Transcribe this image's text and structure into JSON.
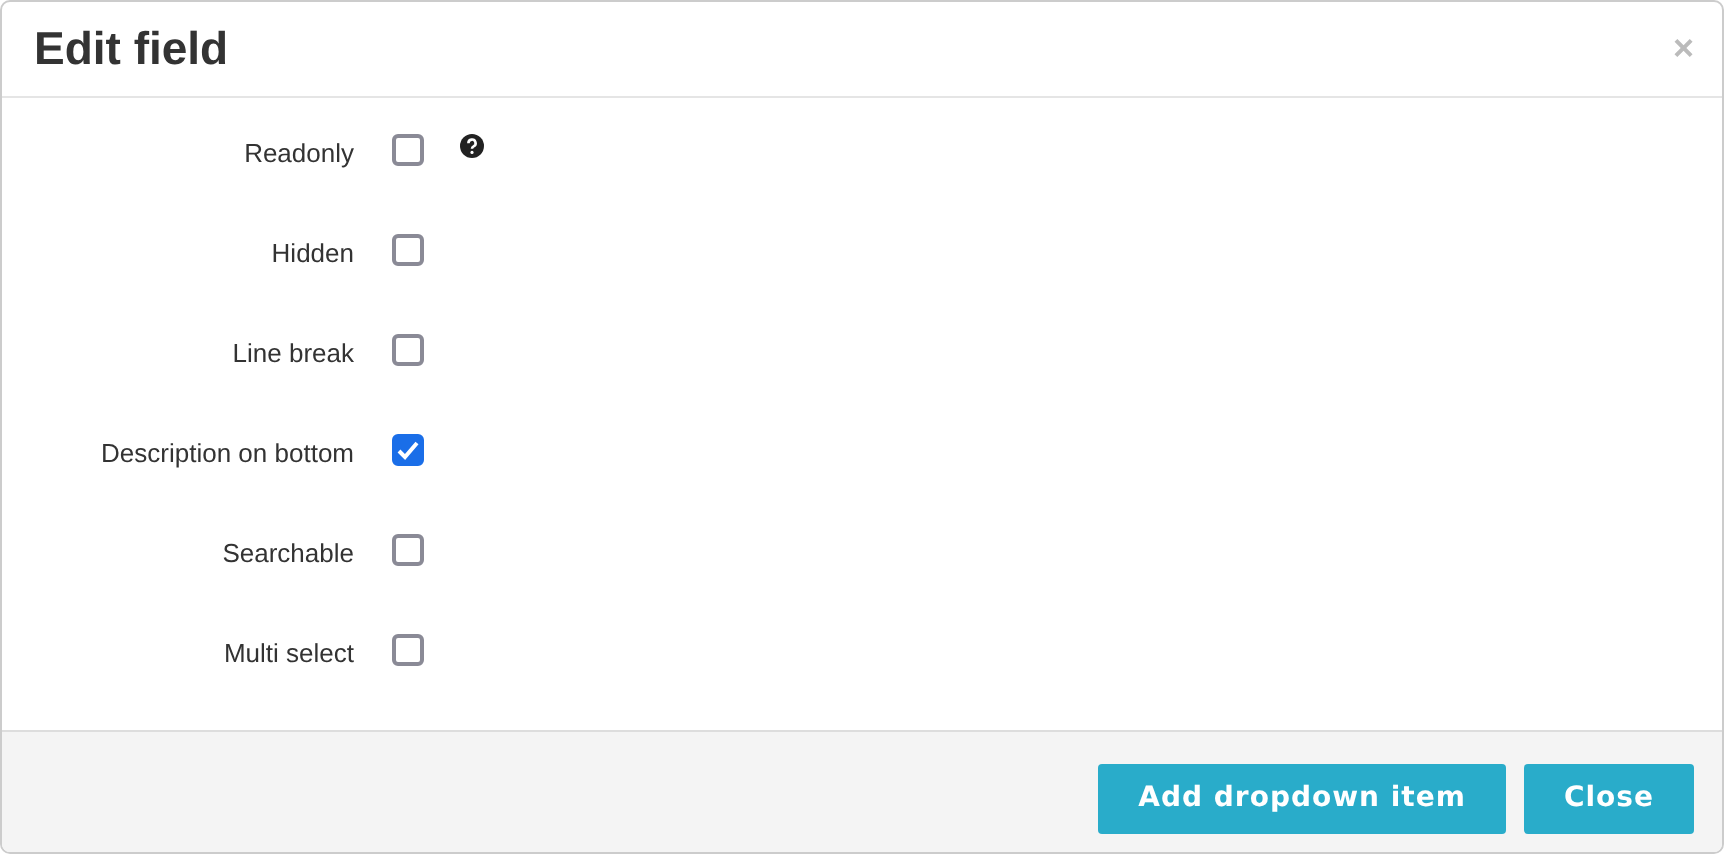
{
  "dialog": {
    "title": "Edit field",
    "close": "×"
  },
  "options": [
    {
      "label": "Readonly",
      "checked": false,
      "help": true
    },
    {
      "label": "Hidden",
      "checked": false,
      "help": false
    },
    {
      "label": "Line break",
      "checked": false,
      "help": false
    },
    {
      "label": "Description on bottom",
      "checked": true,
      "help": false
    },
    {
      "label": "Searchable",
      "checked": false,
      "help": false
    },
    {
      "label": "Multi select",
      "checked": false,
      "help": false
    }
  ],
  "buttons": [
    "Add dropdown item",
    "Close"
  ]
}
